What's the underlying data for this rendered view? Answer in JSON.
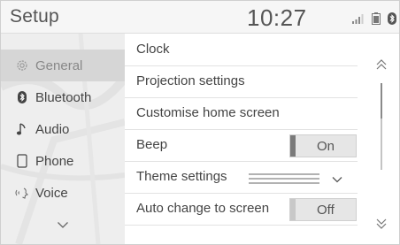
{
  "header": {
    "title": "Setup",
    "time": "10:27",
    "status_icons": [
      "signal-icon",
      "battery-icon",
      "bluetooth-icon"
    ]
  },
  "sidebar": {
    "items": [
      {
        "label": "General",
        "icon": "gear-icon",
        "active": true
      },
      {
        "label": "Bluetooth",
        "icon": "bluetooth-icon",
        "active": false
      },
      {
        "label": "Audio",
        "icon": "music-note-icon",
        "active": false
      },
      {
        "label": "Phone",
        "icon": "phone-icon",
        "active": false
      },
      {
        "label": "Voice",
        "icon": "voice-icon",
        "active": false
      }
    ],
    "more_icon": "chevron-down-icon"
  },
  "list": {
    "items": [
      {
        "label": "Clock"
      },
      {
        "label": "Projection settings"
      },
      {
        "label": "Customise home screen"
      },
      {
        "label": "Beep",
        "toggle": "On"
      },
      {
        "label": "Theme settings"
      },
      {
        "label": "Auto change to screen",
        "toggle": "Off"
      }
    ]
  },
  "scrollbar": {
    "up_icon": "double-chevron-up-icon",
    "down_icon": "double-chevron-down-icon"
  }
}
